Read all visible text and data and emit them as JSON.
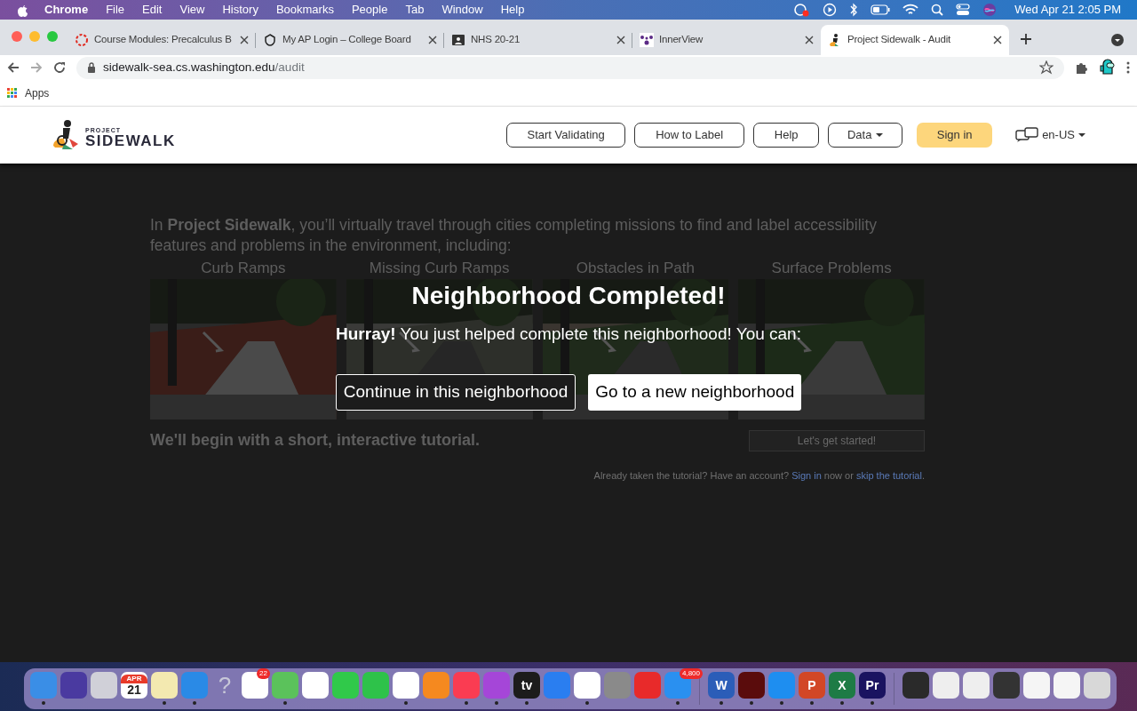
{
  "menu_bar": {
    "app": "Chrome",
    "menus": [
      "File",
      "Edit",
      "View",
      "History",
      "Bookmarks",
      "People",
      "Tab",
      "Window",
      "Help"
    ],
    "clock": "Wed Apr 21  2:05 PM"
  },
  "tabs": [
    {
      "title": "Course Modules: Precalculus B",
      "selected": false
    },
    {
      "title": "My AP Login – College Board",
      "selected": false
    },
    {
      "title": "NHS 20-21",
      "selected": false
    },
    {
      "title": "InnerView",
      "selected": false
    },
    {
      "title": "Project Sidewalk - Audit",
      "selected": true
    }
  ],
  "address": {
    "host": "sidewalk-sea.cs.washington.edu",
    "path": "/audit"
  },
  "bookmarks": [
    "Apps"
  ],
  "site_nav": {
    "logo_small": "PROJECT",
    "logo_big": "SIDEWALK",
    "buttons": [
      {
        "label": "Start Validating",
        "kind": "outline"
      },
      {
        "label": "How to Label",
        "kind": "outline"
      },
      {
        "label": "Help",
        "kind": "outline"
      },
      {
        "label": "Data",
        "kind": "dropdown"
      },
      {
        "label": "Sign in",
        "kind": "primary"
      }
    ],
    "language": "en-US"
  },
  "intro": "In **Project Sidewalk**, you’ll virtually travel through cities completing missions to find and label accessibility features and problems in the environment, including:",
  "categories": [
    "Curb Ramps",
    "Missing Curb Ramps",
    "Obstacles in Path",
    "Surface Problems"
  ],
  "tutorial": "We'll begin with a short, interactive tutorial.",
  "start_button": "Let's get started!",
  "tutorial_note": [
    {
      "kind": "text",
      "text": "Already taken the tutorial? Have an account? "
    },
    {
      "kind": "link",
      "text": "Sign in"
    },
    {
      "kind": "text",
      "text": " now or "
    },
    {
      "kind": "link",
      "text": "skip the tutorial"
    },
    {
      "kind": "text",
      "text": "."
    }
  ],
  "modal": {
    "title": "Neighborhood Completed!",
    "message": "**Hurray!** You just helped complete this neighborhood! You can:",
    "buttons": [
      {
        "label": "Continue in this neighborhood",
        "kind": "outline"
      },
      {
        "label": "Go to a new neighborhood",
        "kind": "filled"
      }
    ]
  },
  "dock": [
    {
      "running": true
    },
    {
      "running": false
    },
    {
      "running": false
    },
    {
      "running": false,
      "glyph_top": "APR",
      "glyph": "21"
    },
    {
      "running": true
    },
    {
      "running": true
    },
    {
      "running": false,
      "glyph": "?"
    },
    {
      "running": false,
      "badge": "22"
    },
    {
      "running": true
    },
    {
      "running": false
    },
    {
      "running": false
    },
    {
      "running": false
    },
    {
      "running": true
    },
    {
      "running": false
    },
    {
      "running": true
    },
    {
      "running": true
    },
    {
      "running": true,
      "glyph": "tv"
    },
    {
      "running": false
    },
    {
      "running": true
    },
    {
      "running": false
    },
    {
      "running": false
    },
    {
      "running": true,
      "badge": "4,800"
    },
    {
      "running": true,
      "glyph": "W"
    },
    {
      "running": true
    },
    {
      "running": true
    },
    {
      "running": true,
      "glyph": "P"
    },
    {
      "running": true,
      "glyph": "X"
    },
    {
      "running": true,
      "glyph": "Pr"
    },
    {
      "running": false
    },
    {
      "running": false
    },
    {
      "running": false
    },
    {
      "running": false
    },
    {
      "running": false
    },
    {
      "running": false
    },
    {
      "running": false
    }
  ]
}
